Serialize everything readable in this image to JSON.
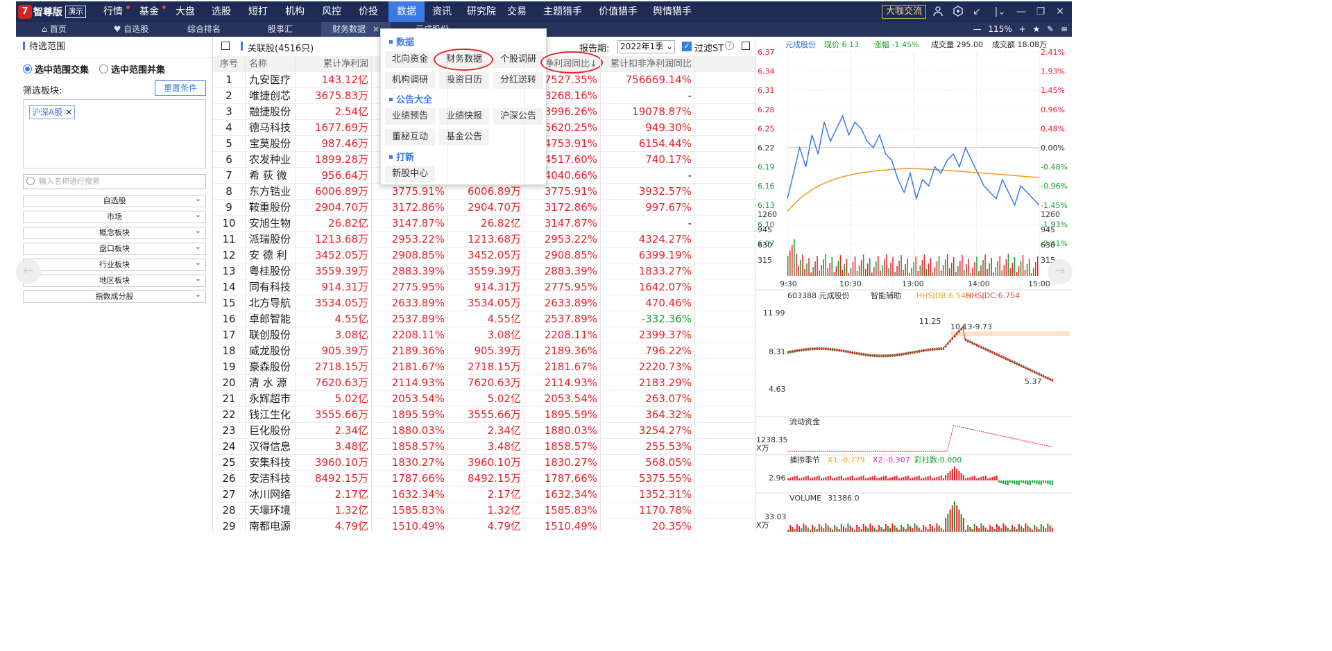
{
  "topbar": {
    "logo": "智尊版",
    "demo": "演示",
    "nav": [
      "行情",
      "基金",
      "大盘",
      "选股",
      "短打",
      "机构",
      "风控",
      "价投",
      "数据",
      "资讯",
      "研究院",
      "交易",
      "主题猎手",
      "价值猎手",
      "舆情猎手"
    ],
    "big_cafe": "大咖交流"
  },
  "tabs": [
    "首页",
    "自选股",
    "综合排名",
    "股事汇",
    "财务数据",
    "元成股份"
  ],
  "zoom": "115%",
  "left": {
    "title": "待选范围",
    "radio_a": "选中范围交集",
    "radio_b": "选中范围并集",
    "board_label": "筛选板块:",
    "reset": "重置条件",
    "board_tag": "沪深A股",
    "search_placeholder": "输入名称进行搜索",
    "dropdowns": [
      "自选股",
      "市场",
      "概念板块",
      "盘口板块",
      "行业板块",
      "地区板块",
      "指数成分股"
    ]
  },
  "table": {
    "title": "关联股(4516只)",
    "report_label": "报告期:",
    "report_value": "2022年1季",
    "filter_st": "过滤ST",
    "headers": [
      "序号",
      "名称",
      "累计净利润",
      "",
      "",
      "净利润同比↓",
      "累计扣非净利润同比"
    ],
    "rows": [
      [
        "1",
        "九安医疗",
        "143.12亿",
        "",
        "",
        "37527.35%",
        "756669.14%"
      ],
      [
        "2",
        "唯捷创芯",
        "3675.83万",
        "",
        "",
        "28268.16%",
        "-"
      ],
      [
        "3",
        "融捷股份",
        "2.54亿",
        "",
        "",
        "13996.26%",
        "19078.87%"
      ],
      [
        "4",
        "德马科技",
        "1677.69万",
        "",
        "",
        "5620.25%",
        "949.30%"
      ],
      [
        "5",
        "宝莫股份",
        "987.46万",
        "",
        "",
        "4753.91%",
        "6154.44%"
      ],
      [
        "6",
        "农发种业",
        "1899.28万",
        "",
        "",
        "4517.60%",
        "740.17%"
      ],
      [
        "7",
        "希 荻 微",
        "956.64万",
        "",
        "",
        "4040.66%",
        "-"
      ],
      [
        "8",
        "东方锆业",
        "6006.89万",
        "3775.91%",
        "6006.89万",
        "3775.91%",
        "3932.57%"
      ],
      [
        "9",
        "鞍重股份",
        "2904.70万",
        "3172.86%",
        "2904.70万",
        "3172.86%",
        "997.67%"
      ],
      [
        "10",
        "安旭生物",
        "26.82亿",
        "3147.87%",
        "26.82亿",
        "3147.87%",
        "-"
      ],
      [
        "11",
        "派瑞股份",
        "1213.68万",
        "2953.22%",
        "1213.68万",
        "2953.22%",
        "4324.27%"
      ],
      [
        "12",
        "安 德 利",
        "3452.05万",
        "2908.85%",
        "3452.05万",
        "2908.85%",
        "6399.19%"
      ],
      [
        "13",
        "粤桂股份",
        "3559.39万",
        "2883.39%",
        "3559.39万",
        "2883.39%",
        "1833.27%"
      ],
      [
        "14",
        "同有科技",
        "914.31万",
        "2775.95%",
        "914.31万",
        "2775.95%",
        "1642.07%"
      ],
      [
        "15",
        "北方导航",
        "3534.05万",
        "2633.89%",
        "3534.05万",
        "2633.89%",
        "470.46%"
      ],
      [
        "16",
        "卓郎智能",
        "4.55亿",
        "2537.89%",
        "4.55亿",
        "2537.89%",
        "-332.36%"
      ],
      [
        "17",
        "联创股份",
        "3.08亿",
        "2208.11%",
        "3.08亿",
        "2208.11%",
        "2399.37%"
      ],
      [
        "18",
        "威龙股份",
        "905.39万",
        "2189.36%",
        "905.39万",
        "2189.36%",
        "796.22%"
      ],
      [
        "19",
        "豪森股份",
        "2718.15万",
        "2181.67%",
        "2718.15万",
        "2181.67%",
        "2220.73%"
      ],
      [
        "20",
        "清 水 源",
        "7620.63万",
        "2114.93%",
        "7620.63万",
        "2114.93%",
        "2183.29%"
      ],
      [
        "21",
        "永辉超市",
        "5.02亿",
        "2053.54%",
        "5.02亿",
        "2053.54%",
        "263.07%"
      ],
      [
        "22",
        "钱江生化",
        "3555.66万",
        "1895.59%",
        "3555.66万",
        "1895.59%",
        "364.32%"
      ],
      [
        "23",
        "巨化股份",
        "2.34亿",
        "1880.03%",
        "2.34亿",
        "1880.03%",
        "3254.27%"
      ],
      [
        "24",
        "汉得信息",
        "3.48亿",
        "1858.57%",
        "3.48亿",
        "1858.57%",
        "255.53%"
      ],
      [
        "25",
        "安集科技",
        "3960.10万",
        "1830.27%",
        "3960.10万",
        "1830.27%",
        "568.05%"
      ],
      [
        "26",
        "安洁科技",
        "8492.15万",
        "1787.66%",
        "8492.15万",
        "1787.66%",
        "5375.55%"
      ],
      [
        "27",
        "冰川网络",
        "2.17亿",
        "1632.34%",
        "2.17亿",
        "1632.34%",
        "1352.31%"
      ],
      [
        "28",
        "天壕环境",
        "1.32亿",
        "1585.83%",
        "1.32亿",
        "1585.83%",
        "1170.78%"
      ],
      [
        "29",
        "南都电源",
        "4.79亿",
        "1510.49%",
        "4.79亿",
        "1510.49%",
        "20.35%"
      ]
    ]
  },
  "menu": {
    "sec1": "数据",
    "row1": [
      "北向资金",
      "财务数据",
      "个股调研"
    ],
    "row2": [
      "机构调研",
      "投资日历",
      "分红送转"
    ],
    "sec2": "公告大全",
    "row3": [
      "业绩预告",
      "业绩快报",
      "沪深公告"
    ],
    "row4": [
      "董秘互动",
      "基金公告"
    ],
    "sec3": "打新",
    "row5": [
      "新股中心"
    ]
  },
  "chart": {
    "stock": "元成股份",
    "price_label": "现价 6.13",
    "change_label": "涨幅 -1.45%",
    "volume_label": "成交量 295.00",
    "amount_label": "成交额 18.08万",
    "y_left": [
      "6.37",
      "6.34",
      "6.31",
      "6.28",
      "6.25",
      "6.22",
      "6.19",
      "6.16",
      "6.13",
      "6.10",
      "6.07"
    ],
    "y_right": [
      "2.41%",
      "1.93%",
      "1.45%",
      "0.96%",
      "0.48%",
      "0.00%",
      "-0.48%",
      "-0.96%",
      "-1.45%",
      "-1.93%",
      "-2.41%"
    ],
    "vol_ticks": [
      "1260",
      "945",
      "630",
      "315"
    ],
    "times": [
      "9:30",
      "10:30",
      "13:00",
      "14:00",
      "15:00"
    ],
    "code_line": "603388 元成股份",
    "assist": "智能辅助",
    "hhsjdb": "HHSJDB:6.545",
    "hhsjdc": "HHSJDC:6.754",
    "k_high": "11.99",
    "k_mid": "8.31",
    "k_low": "4.63",
    "k_peak": "11.25",
    "k_range": "10.13-9.73",
    "k_min": "5.37",
    "flow_title": "流动资金",
    "flow_val": "1238.35",
    "flow_unit": "X万",
    "season_title": "捕捞季节",
    "x1": "X1:-0.779",
    "x2": "X2:-0.307",
    "bar_val": "彩柱数:0.000",
    "season_val": "2.96",
    "vol_title": "VOLUME",
    "vol_val": "31386.0",
    "vol_low": "33.03",
    "vol_unit": "X万"
  }
}
